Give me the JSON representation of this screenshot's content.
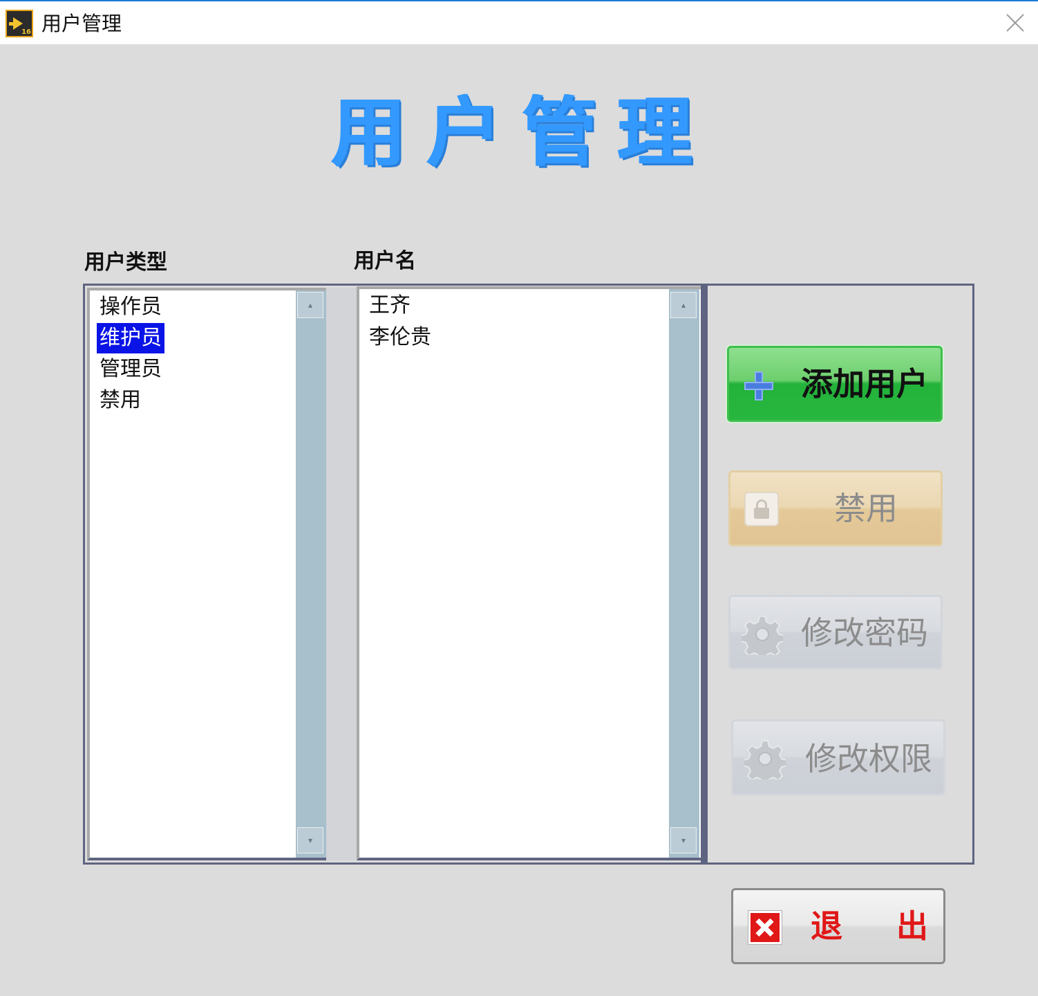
{
  "window": {
    "title": "用户管理"
  },
  "page": {
    "heading": "用户管理"
  },
  "user_type": {
    "label": "用户类型",
    "items": [
      "操作员",
      "维护员",
      "管理员",
      "禁用"
    ],
    "selected": "维护员"
  },
  "user_name": {
    "label": "用户名",
    "items": [
      "王齐",
      "李伦贵"
    ]
  },
  "buttons": {
    "add": "添加用户",
    "disable": "禁用",
    "change_password": "修改密码",
    "change_permission": "修改权限",
    "exit_1": "退",
    "exit_2": "出"
  },
  "colors": {
    "heading": "#3399ff",
    "selection": "#0a14e6",
    "add_button": "#23b23a",
    "exit_text": "#e01818"
  },
  "icons": {
    "app": "labview-app-icon",
    "close": "close-icon",
    "add": "plus-icon",
    "disable": "lock-icon",
    "change_password": "gear-icon",
    "change_permission": "gear-icon",
    "exit": "x-icon"
  }
}
